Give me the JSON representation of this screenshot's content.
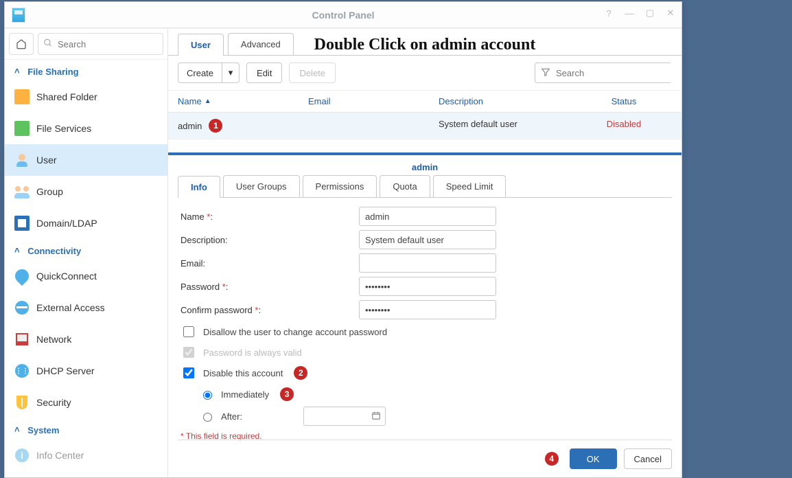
{
  "window": {
    "title": "Control Panel",
    "headline": "Double Click on admin account"
  },
  "sidebar": {
    "search_placeholder": "Search",
    "sections": {
      "file_sharing": "File Sharing",
      "connectivity": "Connectivity",
      "system": "System"
    },
    "items": {
      "shared_folder": "Shared Folder",
      "file_services": "File Services",
      "user": "User",
      "group": "Group",
      "domain_ldap": "Domain/LDAP",
      "quickconnect": "QuickConnect",
      "external_access": "External Access",
      "network": "Network",
      "dhcp_server": "DHCP Server",
      "security": "Security",
      "info_center": "Info Center"
    }
  },
  "tabs_top": {
    "user": "User",
    "advanced": "Advanced"
  },
  "toolbar": {
    "create": "Create",
    "edit": "Edit",
    "delete": "Delete",
    "search_placeholder": "Search"
  },
  "table": {
    "cols": {
      "name": "Name",
      "email": "Email",
      "description": "Description",
      "status": "Status"
    },
    "rows": [
      {
        "name": "admin",
        "email": "",
        "description": "System default user",
        "status": "Disabled"
      }
    ]
  },
  "dialog": {
    "title": "admin",
    "tabs": {
      "info": "Info",
      "user_groups": "User Groups",
      "permissions": "Permissions",
      "quota": "Quota",
      "speed_limit": "Speed Limit"
    },
    "labels": {
      "name": "Name",
      "description": "Description:",
      "email": "Email:",
      "password": "Password",
      "confirm_password": "Confirm password",
      "disallow_change": "Disallow the user to change account password",
      "password_always_valid": "Password is always valid",
      "disable_account": "Disable this account",
      "immediately": "Immediately",
      "after": "After:",
      "required_note": "* This field is required."
    },
    "values": {
      "name": "admin",
      "description": "System default user",
      "email": "",
      "password": "••••••••",
      "confirm_password": "••••••••",
      "disallow_change_checked": false,
      "password_always_valid_checked": true,
      "disable_account_checked": true,
      "disable_mode": "immediately",
      "after_date": ""
    },
    "buttons": {
      "ok": "OK",
      "cancel": "Cancel"
    }
  },
  "callouts": {
    "c1": "1",
    "c2": "2",
    "c3": "3",
    "c4": "4"
  }
}
